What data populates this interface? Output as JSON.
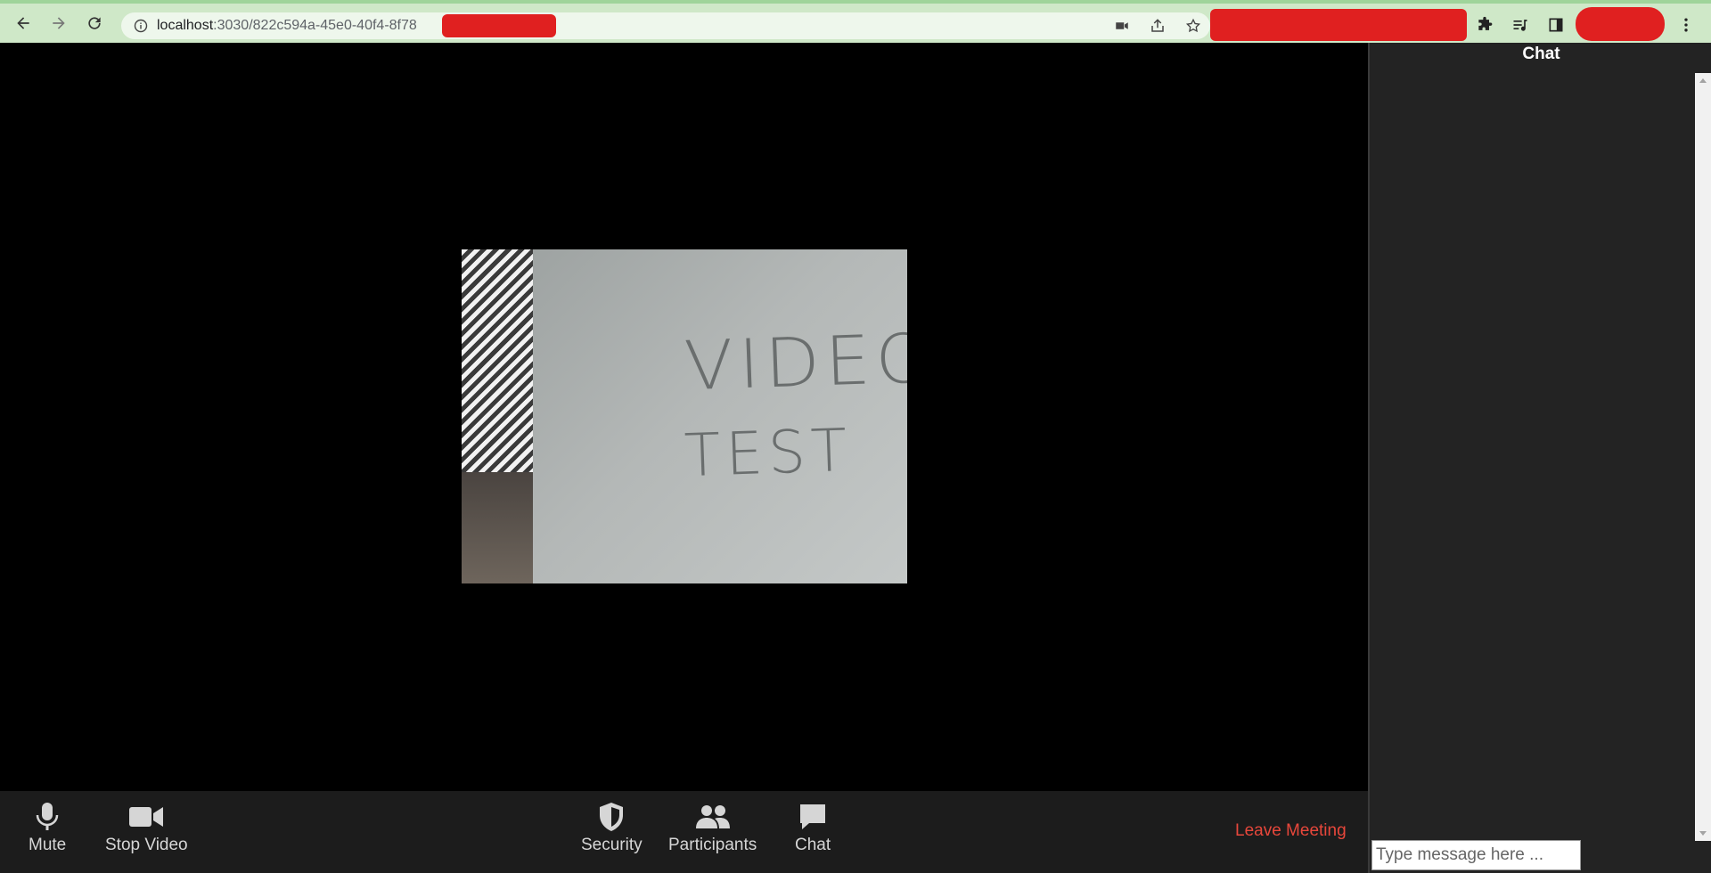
{
  "browser": {
    "url_host": "localhost",
    "url_path": ":3030/822c594a-45e0-40f4-8f78"
  },
  "video": {
    "line1": "VIDEO",
    "line2": "TEST"
  },
  "toolbar": {
    "mute": "Mute",
    "stop_video": "Stop Video",
    "security": "Security",
    "participants": "Participants",
    "chat": "Chat",
    "leave": "Leave Meeting"
  },
  "chat_panel": {
    "title": "Chat",
    "input_placeholder": "Type message here ..."
  },
  "colors": {
    "leave_accent": "#e8473b",
    "toolbar_bg": "#1c1c1c",
    "chat_bg": "#232323",
    "browser_bar": "#cfe8c8"
  }
}
